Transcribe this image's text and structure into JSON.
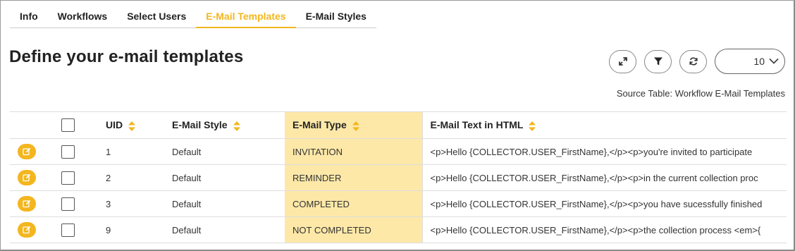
{
  "tabs": [
    {
      "label": "Info",
      "active": false
    },
    {
      "label": "Workflows",
      "active": false
    },
    {
      "label": "Select Users",
      "active": false
    },
    {
      "label": "E-Mail Templates",
      "active": true
    },
    {
      "label": "E-Mail Styles",
      "active": false
    }
  ],
  "page_title": "Define your e-mail templates",
  "toolbar": {
    "expand_icon": "expand-icon",
    "filter_icon": "filter-icon",
    "refresh_icon": "refresh-icon",
    "page_size": "10"
  },
  "source_label": "Source Table: Workflow E-Mail Templates",
  "table": {
    "columns": [
      "UID",
      "E-Mail Style",
      "E-Mail Type",
      "E-Mail Text in HTML"
    ],
    "rows": [
      {
        "uid": "1",
        "style": "Default",
        "type": "INVITATION",
        "text": "<p>Hello {COLLECTOR.USER_FirstName},</p><p>you're invited to participate"
      },
      {
        "uid": "2",
        "style": "Default",
        "type": "REMINDER",
        "text": "<p>Hello {COLLECTOR.USER_FirstName},</p><p>in the current collection proc"
      },
      {
        "uid": "3",
        "style": "Default",
        "type": "COMPLETED",
        "text": "<p>Hello {COLLECTOR.USER_FirstName},</p><p>you have sucessfully finished"
      },
      {
        "uid": "9",
        "style": "Default",
        "type": "NOT COMPLETED",
        "text": "<p>Hello {COLLECTOR.USER_FirstName},</p><p>the collection process <em>{"
      }
    ]
  },
  "colors": {
    "accent": "#f3b61f",
    "highlight_column": "#fde8a8"
  }
}
